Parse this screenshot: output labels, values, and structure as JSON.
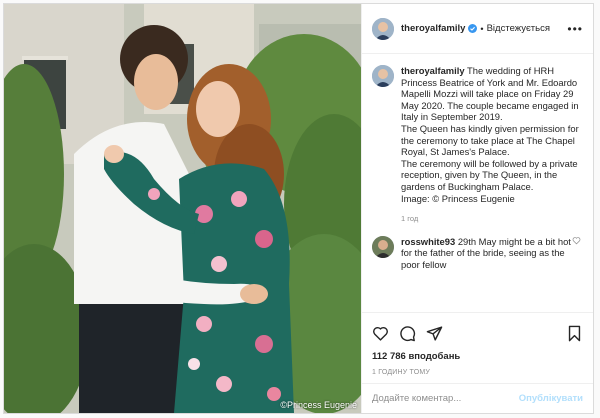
{
  "photo": {
    "credit": "©Princess Eugenie"
  },
  "header": {
    "username": "theroyalfamily",
    "separator": "•",
    "follow_status": "Відстежується",
    "more_icon": "more-dots-icon"
  },
  "caption": {
    "username": "theroyalfamily",
    "lines": [
      "The wedding of HRH Princess Beatrice of York and Mr. Edoardo Mapelli Mozzi will take place on Friday 29 May 2020. The couple became engaged in Italy in September 2019.",
      "The Queen has kindly given permission for the ceremony to take place at The Chapel Royal, St James's Palace.",
      "The ceremony will be followed by a private reception, given by The Queen, in the gardens of Buckingham Palace.",
      "Image: © Princess Eugenie"
    ],
    "age": "1 год"
  },
  "comment": {
    "username": "rosswhite93",
    "text": "29th May might be a bit hot for the father of the bride, seeing as the poor fellow"
  },
  "actions": {
    "icons": [
      "heart-icon",
      "comment-icon",
      "share-icon",
      "bookmark-icon"
    ],
    "likes": "112 786 вподобань",
    "time_ago": "1 ГОДИНУ ТОМУ"
  },
  "comment_box": {
    "placeholder": "Додайте коментар...",
    "publish_label": "Опублікувати"
  },
  "colors": {
    "accent": "#0095f6",
    "publish_disabled": "#b2dffc",
    "verified": "#3897f0",
    "dress": "#1f6b5f"
  }
}
